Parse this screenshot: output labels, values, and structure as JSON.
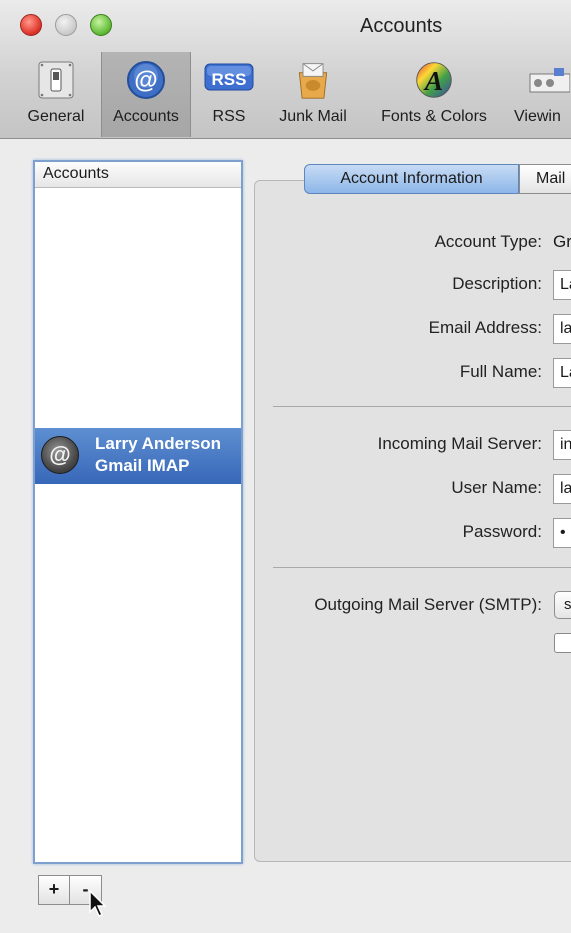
{
  "window": {
    "title": "Accounts"
  },
  "toolbar": {
    "items": [
      {
        "label": "General",
        "icon": "general-switch-icon"
      },
      {
        "label": "Accounts",
        "icon": "at-sign-icon"
      },
      {
        "label": "RSS",
        "icon": "rss-icon"
      },
      {
        "label": "Junk Mail",
        "icon": "junk-mail-icon"
      },
      {
        "label": "Fonts & Colors",
        "icon": "fonts-colors-icon"
      },
      {
        "label": "Viewin",
        "icon": "viewing-icon"
      }
    ],
    "selected": "Accounts"
  },
  "accounts_list": {
    "header": "Accounts",
    "items": [
      {
        "name": "Larry Anderson",
        "type": "Gmail IMAP",
        "avatar": "@",
        "selected": true
      }
    ]
  },
  "buttons": {
    "add": "+",
    "remove": "-"
  },
  "tabs": [
    "Account Information",
    "Mail"
  ],
  "form": {
    "account_type": {
      "label": "Account Type:",
      "value": "Gr"
    },
    "description": {
      "label": "Description:",
      "value": "La"
    },
    "email": {
      "label": "Email Address:",
      "value": "la"
    },
    "full_name": {
      "label": "Full Name:",
      "value": "La"
    },
    "incoming_server": {
      "label": "Incoming Mail Server:",
      "value": "in"
    },
    "user_name": {
      "label": "User Name:",
      "value": "la"
    },
    "password": {
      "label": "Password:",
      "value": "•"
    },
    "outgoing_server": {
      "label": "Outgoing Mail Server (SMTP):",
      "value": "s"
    }
  },
  "colors": {
    "selection": "#3767b8",
    "tab_active": "#8db6e8"
  }
}
